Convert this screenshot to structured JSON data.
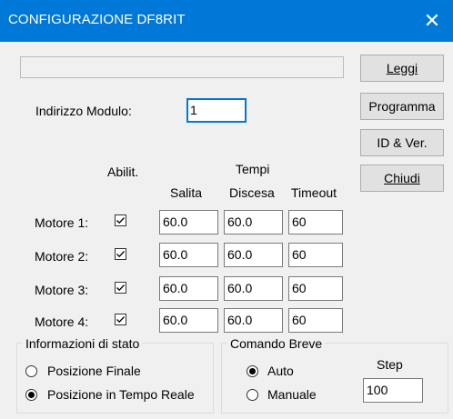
{
  "window": {
    "title": "CONFIGURAZIONE DF8RIT",
    "close_glyph": "✕"
  },
  "buttons": {
    "leggi": "Leggi",
    "programma": "Programma",
    "id_ver": "ID & Ver.",
    "chiudi": "Chiudi"
  },
  "module_address": {
    "label": "Indirizzo Modulo:",
    "value": "1"
  },
  "columns": {
    "abilit": "Abilit.",
    "tempi": "Tempi",
    "salita": "Salita",
    "discesa": "Discesa",
    "timeout": "Timeout"
  },
  "motors": [
    {
      "label": "Motore 1:",
      "enabled": true,
      "salita": "60.0",
      "discesa": "60.0",
      "timeout": "60"
    },
    {
      "label": "Motore 2:",
      "enabled": true,
      "salita": "60.0",
      "discesa": "60.0",
      "timeout": "60"
    },
    {
      "label": "Motore 3:",
      "enabled": true,
      "salita": "60.0",
      "discesa": "60.0",
      "timeout": "60"
    },
    {
      "label": "Motore 4:",
      "enabled": true,
      "salita": "60.0",
      "discesa": "60.0",
      "timeout": "60"
    }
  ],
  "status_info": {
    "title": "Informazioni di stato",
    "options": [
      {
        "label": "Posizione Finale",
        "selected": false
      },
      {
        "label": "Posizione in Tempo Reale",
        "selected": true
      }
    ]
  },
  "short_command": {
    "title": "Comando Breve",
    "options": [
      {
        "label": "Auto",
        "selected": true
      },
      {
        "label": "Manuale",
        "selected": false
      }
    ],
    "step_label": "Step",
    "step_value": "100"
  },
  "colors": {
    "titlebar": "#0078d7",
    "focus_border": "#0078d7"
  }
}
